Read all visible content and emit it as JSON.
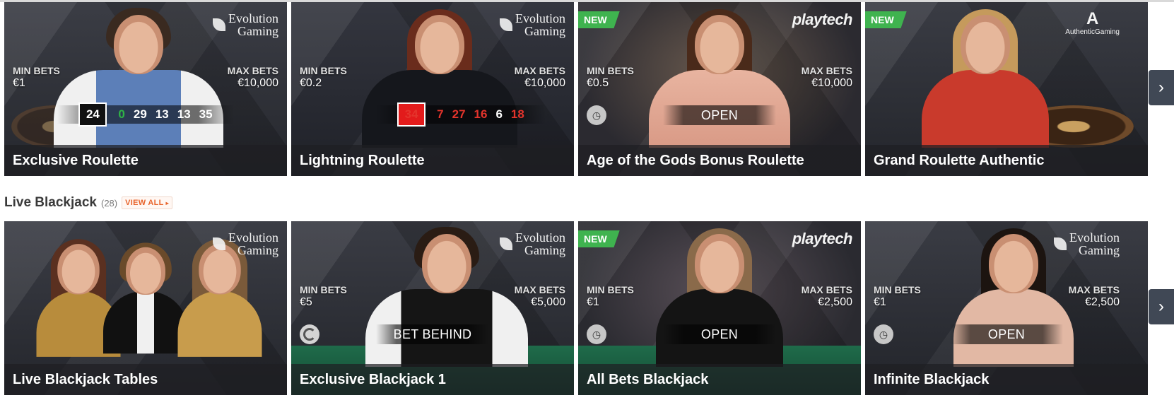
{
  "section_roulette": {
    "tiles": [
      {
        "title": "Exclusive Roulette",
        "provider": "evolution",
        "provider_text": [
          "Evolution",
          "Gaming"
        ],
        "new": false,
        "min_label": "MIN BETS",
        "min_value": "€1",
        "max_label": "MAX BETS",
        "max_value": "€10,000",
        "results": [
          {
            "n": "24",
            "color": "black",
            "first": true
          },
          {
            "n": "0",
            "color": "green"
          },
          {
            "n": "29",
            "color": "black"
          },
          {
            "n": "13",
            "color": "black"
          },
          {
            "n": "13",
            "color": "black"
          },
          {
            "n": "35",
            "color": "black"
          }
        ]
      },
      {
        "title": "Lightning Roulette",
        "provider": "evolution",
        "provider_text": [
          "Evolution",
          "Gaming"
        ],
        "new": false,
        "min_label": "MIN BETS",
        "min_value": "€0.2",
        "max_label": "MAX BETS",
        "max_value": "€10,000",
        "results": [
          {
            "n": "34",
            "color": "red",
            "first": true
          },
          {
            "n": "7",
            "color": "red"
          },
          {
            "n": "27",
            "color": "red"
          },
          {
            "n": "16",
            "color": "red"
          },
          {
            "n": "6",
            "color": "black"
          },
          {
            "n": "18",
            "color": "red"
          }
        ]
      },
      {
        "title": "Age of the Gods Bonus Roulette",
        "provider": "playtech",
        "provider_text": [
          "playtech"
        ],
        "new": true,
        "new_label": "NEW",
        "min_label": "MIN BETS",
        "min_value": "€0.5",
        "max_label": "MAX BETS",
        "max_value": "€10,000",
        "status_icon": "clock-icon",
        "status": "OPEN"
      },
      {
        "title": "Grand Roulette Authentic",
        "provider": "authentic",
        "provider_text": [
          "AuthenticGaming"
        ],
        "new": true,
        "new_label": "NEW"
      }
    ]
  },
  "section_blackjack": {
    "title": "Live Blackjack",
    "count": "(28)",
    "view_all": "VIEW ALL",
    "tiles": [
      {
        "title": "Live Blackjack Tables",
        "provider": "evolution",
        "provider_text": [
          "Evolution",
          "Gaming"
        ],
        "new": false
      },
      {
        "title": "Exclusive Blackjack 1",
        "provider": "evolution",
        "provider_text": [
          "Evolution",
          "Gaming"
        ],
        "new": false,
        "min_label": "MIN BETS",
        "min_value": "€5",
        "max_label": "MAX BETS",
        "max_value": "€5,000",
        "status_icon": "bet-behind-icon",
        "status": "BET BEHIND"
      },
      {
        "title": "All Bets Blackjack",
        "provider": "playtech",
        "provider_text": [
          "playtech"
        ],
        "new": true,
        "new_label": "NEW",
        "min_label": "MIN BETS",
        "min_value": "€1",
        "max_label": "MAX BETS",
        "max_value": "€2,500",
        "status_icon": "clock-icon",
        "status": "OPEN"
      },
      {
        "title": "Infinite Blackjack",
        "provider": "evolution",
        "provider_text": [
          "Evolution",
          "Gaming"
        ],
        "new": false,
        "min_label": "MIN BETS",
        "min_value": "€1",
        "max_label": "MAX BETS",
        "max_value": "€2,500",
        "status_icon": "clock-icon",
        "status": "OPEN"
      }
    ]
  },
  "nav": {
    "next_arrow": "›"
  },
  "colors": {
    "new_badge": "#3fb34f",
    "view_all": "#e8632b",
    "red_number": "#e4342c",
    "green_number": "#2fb546"
  }
}
